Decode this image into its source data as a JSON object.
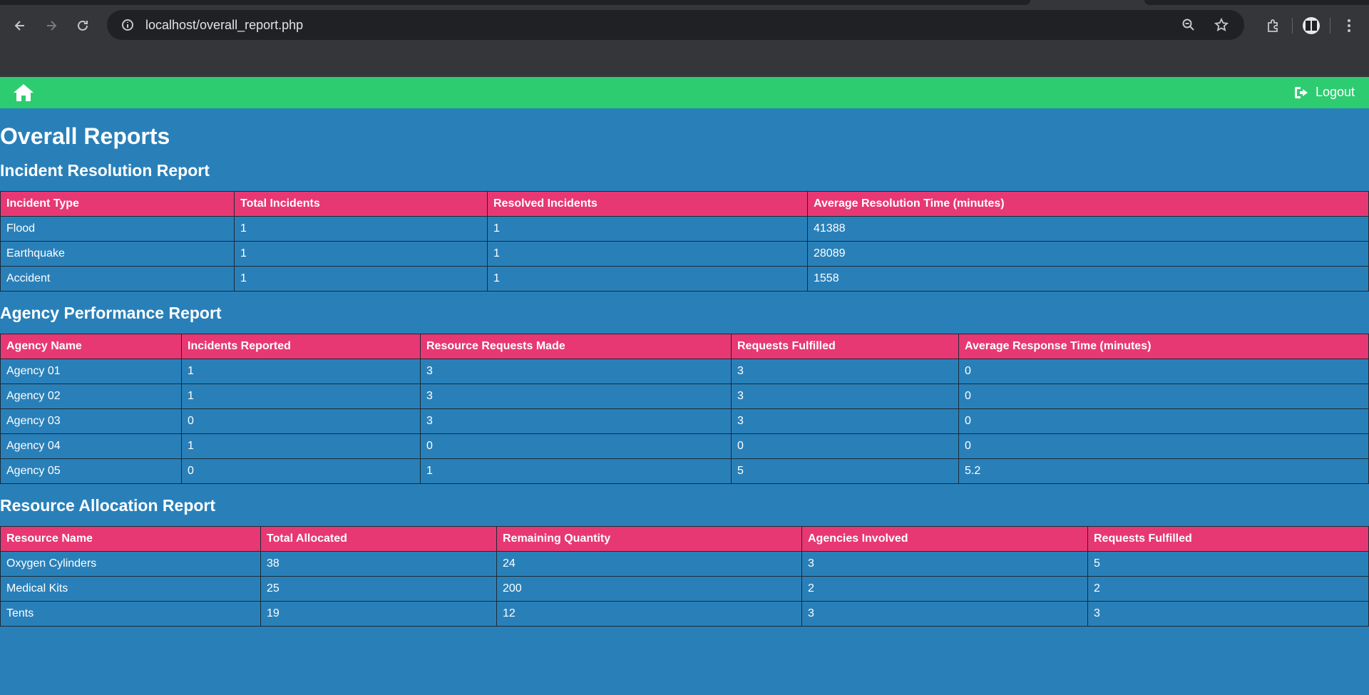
{
  "browser": {
    "url": "localhost/overall_report.php"
  },
  "navbar": {
    "logout_label": "Logout"
  },
  "page": {
    "title": "Overall Reports"
  },
  "incident_report": {
    "title": "Incident Resolution Report",
    "headers": [
      "Incident Type",
      "Total Incidents",
      "Resolved Incidents",
      "Average Resolution Time (minutes)"
    ],
    "rows": [
      [
        "Flood",
        "1",
        "1",
        "41388"
      ],
      [
        "Earthquake",
        "1",
        "1",
        "28089"
      ],
      [
        "Accident",
        "1",
        "1",
        "1558"
      ]
    ]
  },
  "agency_report": {
    "title": "Agency Performance Report",
    "headers": [
      "Agency Name",
      "Incidents Reported",
      "Resource Requests Made",
      "Requests Fulfilled",
      "Average Response Time (minutes)"
    ],
    "rows": [
      [
        "Agency 01",
        "1",
        "3",
        "3",
        "0"
      ],
      [
        "Agency 02",
        "1",
        "3",
        "3",
        "0"
      ],
      [
        "Agency 03",
        "0",
        "3",
        "3",
        "0"
      ],
      [
        "Agency 04",
        "1",
        "0",
        "0",
        "0"
      ],
      [
        "Agency 05",
        "0",
        "1",
        "5",
        "5.2"
      ]
    ]
  },
  "resource_report": {
    "title": "Resource Allocation Report",
    "headers": [
      "Resource Name",
      "Total Allocated",
      "Remaining Quantity",
      "Agencies Involved",
      "Requests Fulfilled"
    ],
    "rows": [
      [
        "Oxygen Cylinders",
        "38",
        "24",
        "3",
        "5"
      ],
      [
        "Medical Kits",
        "25",
        "200",
        "2",
        "2"
      ],
      [
        "Tents",
        "19",
        "12",
        "3",
        "3"
      ]
    ]
  },
  "colors": {
    "navbar": "#2ecc71",
    "background": "#2980b9",
    "table_header": "#e73874"
  },
  "icons": [
    "back-icon",
    "forward-icon",
    "reload-icon",
    "site-info-icon",
    "zoom-icon",
    "star-icon",
    "extensions-icon",
    "profile-icon",
    "menu-icon",
    "home-icon",
    "logout-icon"
  ]
}
